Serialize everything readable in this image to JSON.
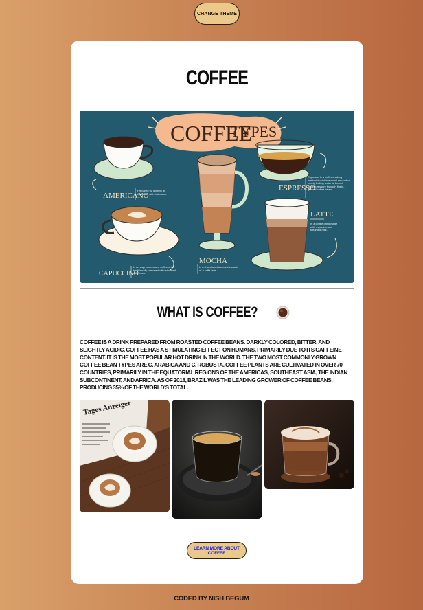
{
  "header": {
    "theme_button_label": "CHANGE THEME"
  },
  "card": {
    "title": "COFFEE",
    "infographic": {
      "title_coffee": "COFFEE",
      "title_types": "TYPES",
      "labels": {
        "americano": "AMERICANO",
        "americano_desc": "Prepared by diluting an espresso with hot water.",
        "espresso": "ESPRESSO",
        "espresso_desc": "Espresso is a coffee-making method in which a small amount of nearly boiling water is forced under pressure through finely-ground coffee beans.",
        "latte": "LATTE",
        "latte_desc": "Is a coffee drink made with espresso and steamed milk.",
        "mocha": "MOCHA",
        "mocha_desc": "Is a chocolate-flavoured variant of a caffè latte.",
        "cappuccino": "CAPUCCINO",
        "cappuccino_desc": "Is an espresso-based coffee drink traditionally prepared with steamed milk foam."
      }
    },
    "what_heading": "WHAT IS COFFEE?",
    "what_icon": "coffee-cup-emoji",
    "what_body": "Coffee is a drink prepared from roasted coffee beans. Darkly colored, bitter, and slightly acidic, coffee has a stimulating effect on humans, primarily due to its caffeine content. It is the most popular hot drink in the world. The two most commonly grown coffee bean types are C. arabica and C. robusta. Coffee plants are cultivated in over 70 countries, primarily in the equatorial regions of the Americas, Southeast Asia, the Indian subcontinent, and Africa. As of 2018, Brazil was the leading grower of coffee beans, producing 35% of the world's total.",
    "gallery": {
      "photo1_newspaper_text": "Tages Anzeiger"
    },
    "learn_button_label": "LEARN MORE ABOUT COFFEE"
  },
  "footer": {
    "credit": "CODED BY NISH BEGUM"
  },
  "colors": {
    "background_left": "#d9a06a",
    "background_right": "#b8673f",
    "button_fill": "#ebc98a",
    "link_text": "#1b1bd0",
    "infographic_bg": "#235a6d",
    "infographic_title_blob": "#f4b98f"
  }
}
